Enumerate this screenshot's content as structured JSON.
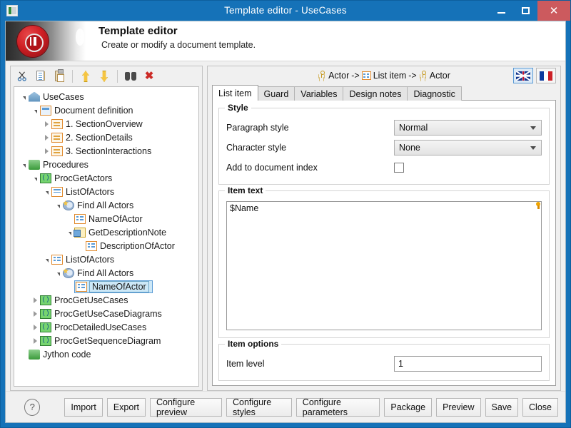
{
  "window": {
    "title": "Template editor - UseCases",
    "icon": "app-window-icon",
    "minimize_label": "–",
    "maximize_label": "□",
    "close_label": "✕"
  },
  "banner": {
    "title": "Template editor",
    "subtitle": "Create or modify a document template.",
    "logo": "red-disc-logo"
  },
  "tree_toolbar": {
    "buttons": [
      {
        "name": "cut-icon",
        "tooltip": "Cut"
      },
      {
        "name": "copy-icon",
        "tooltip": "Copy"
      },
      {
        "name": "paste-icon",
        "tooltip": "Paste"
      },
      {
        "name": "move-up-icon",
        "tooltip": "Move up"
      },
      {
        "name": "move-down-icon",
        "tooltip": "Move down"
      },
      {
        "name": "find-icon",
        "tooltip": "Find"
      },
      {
        "name": "delete-icon",
        "tooltip": "Delete"
      }
    ]
  },
  "tree": {
    "nodes": [
      {
        "label": "UseCases",
        "indent": 0,
        "twist": "open",
        "icon": "ic-house",
        "selected": false
      },
      {
        "label": "Document definition",
        "indent": 1,
        "twist": "open",
        "icon": "ic-doc",
        "selected": false
      },
      {
        "label": "1. SectionOverview",
        "indent": 2,
        "twist": "closed",
        "icon": "ic-doc2",
        "selected": false
      },
      {
        "label": "2. SectionDetails",
        "indent": 2,
        "twist": "closed",
        "icon": "ic-doc2",
        "selected": false
      },
      {
        "label": "3. SectionInteractions",
        "indent": 2,
        "twist": "closed",
        "icon": "ic-doc2",
        "selected": false
      },
      {
        "label": "Procedures",
        "indent": 0,
        "twist": "open",
        "icon": "ic-folder",
        "selected": false
      },
      {
        "label": "ProcGetActors",
        "indent": 1,
        "twist": "open",
        "icon": "ic-paren",
        "selected": false
      },
      {
        "label": "ListOfActors",
        "indent": 2,
        "twist": "open",
        "icon": "ic-table",
        "selected": false
      },
      {
        "label": "Find All Actors",
        "indent": 3,
        "twist": "open",
        "icon": "ic-find",
        "selected": false
      },
      {
        "label": "NameOfActor",
        "indent": 4,
        "twist": "none",
        "icon": "ic-list",
        "selected": false
      },
      {
        "label": "GetDescriptionNote",
        "indent": 4,
        "twist": "open",
        "icon": "ic-note",
        "selected": false
      },
      {
        "label": "DescriptionOfActor",
        "indent": 5,
        "twist": "none",
        "icon": "ic-list",
        "selected": false
      },
      {
        "label": "ListOfActors",
        "indent": 2,
        "twist": "open",
        "icon": "ic-list",
        "selected": false
      },
      {
        "label": "Find All Actors",
        "indent": 3,
        "twist": "open",
        "icon": "ic-find",
        "selected": false
      },
      {
        "label": "NameOfActor",
        "indent": 4,
        "twist": "none",
        "icon": "ic-list",
        "selected": true
      },
      {
        "label": "ProcGetUseCases",
        "indent": 1,
        "twist": "closed",
        "icon": "ic-paren",
        "selected": false
      },
      {
        "label": "ProcGetUseCaseDiagrams",
        "indent": 1,
        "twist": "closed",
        "icon": "ic-paren",
        "selected": false
      },
      {
        "label": "ProcDetailedUseCases",
        "indent": 1,
        "twist": "closed",
        "icon": "ic-paren",
        "selected": false
      },
      {
        "label": "ProcGetSequenceDiagram",
        "indent": 1,
        "twist": "closed",
        "icon": "ic-paren",
        "selected": false
      },
      {
        "label": "Jython code",
        "indent": 0,
        "twist": "none",
        "icon": "ic-folder",
        "selected": false
      }
    ],
    "paren_glyph": "()"
  },
  "breadcrumb": {
    "segments": [
      "Actor",
      "List item",
      "Actor"
    ],
    "separator": "->"
  },
  "languages": {
    "selected": "en",
    "options": [
      {
        "code": "en",
        "name": "uk-flag-icon",
        "active": true
      },
      {
        "code": "fr",
        "name": "france-flag-icon",
        "active": false
      }
    ]
  },
  "tabs": {
    "active": "List item",
    "items": [
      "List item",
      "Guard",
      "Variables",
      "Design notes",
      "Diagnostic"
    ]
  },
  "style_group": {
    "legend": "Style",
    "paragraph_style_label": "Paragraph style",
    "paragraph_style_value": "Normal",
    "character_style_label": "Character style",
    "character_style_value": "None",
    "add_to_index_label": "Add to document index",
    "add_to_index_checked": false
  },
  "item_text_group": {
    "legend": "Item text",
    "value": "$Name",
    "hint_marker": "lightbulb-icon"
  },
  "item_options_group": {
    "legend": "Item options",
    "item_level_label": "Item level",
    "item_level_value": "1"
  },
  "footer": {
    "help_label": "?",
    "buttons": [
      "Import",
      "Export",
      "Configure preview",
      "Configure styles",
      "Configure parameters",
      "Package",
      "Preview",
      "Save",
      "Close"
    ]
  },
  "colors": {
    "window_chrome": "#1572b8",
    "close_button": "#cc5a5e",
    "selection_fill": "#cde8f7",
    "selection_border": "#5b9bd5",
    "accent_orange": "#e08a2e",
    "accent_green": "#3a9a3a",
    "delete_red": "#cc2a26"
  }
}
